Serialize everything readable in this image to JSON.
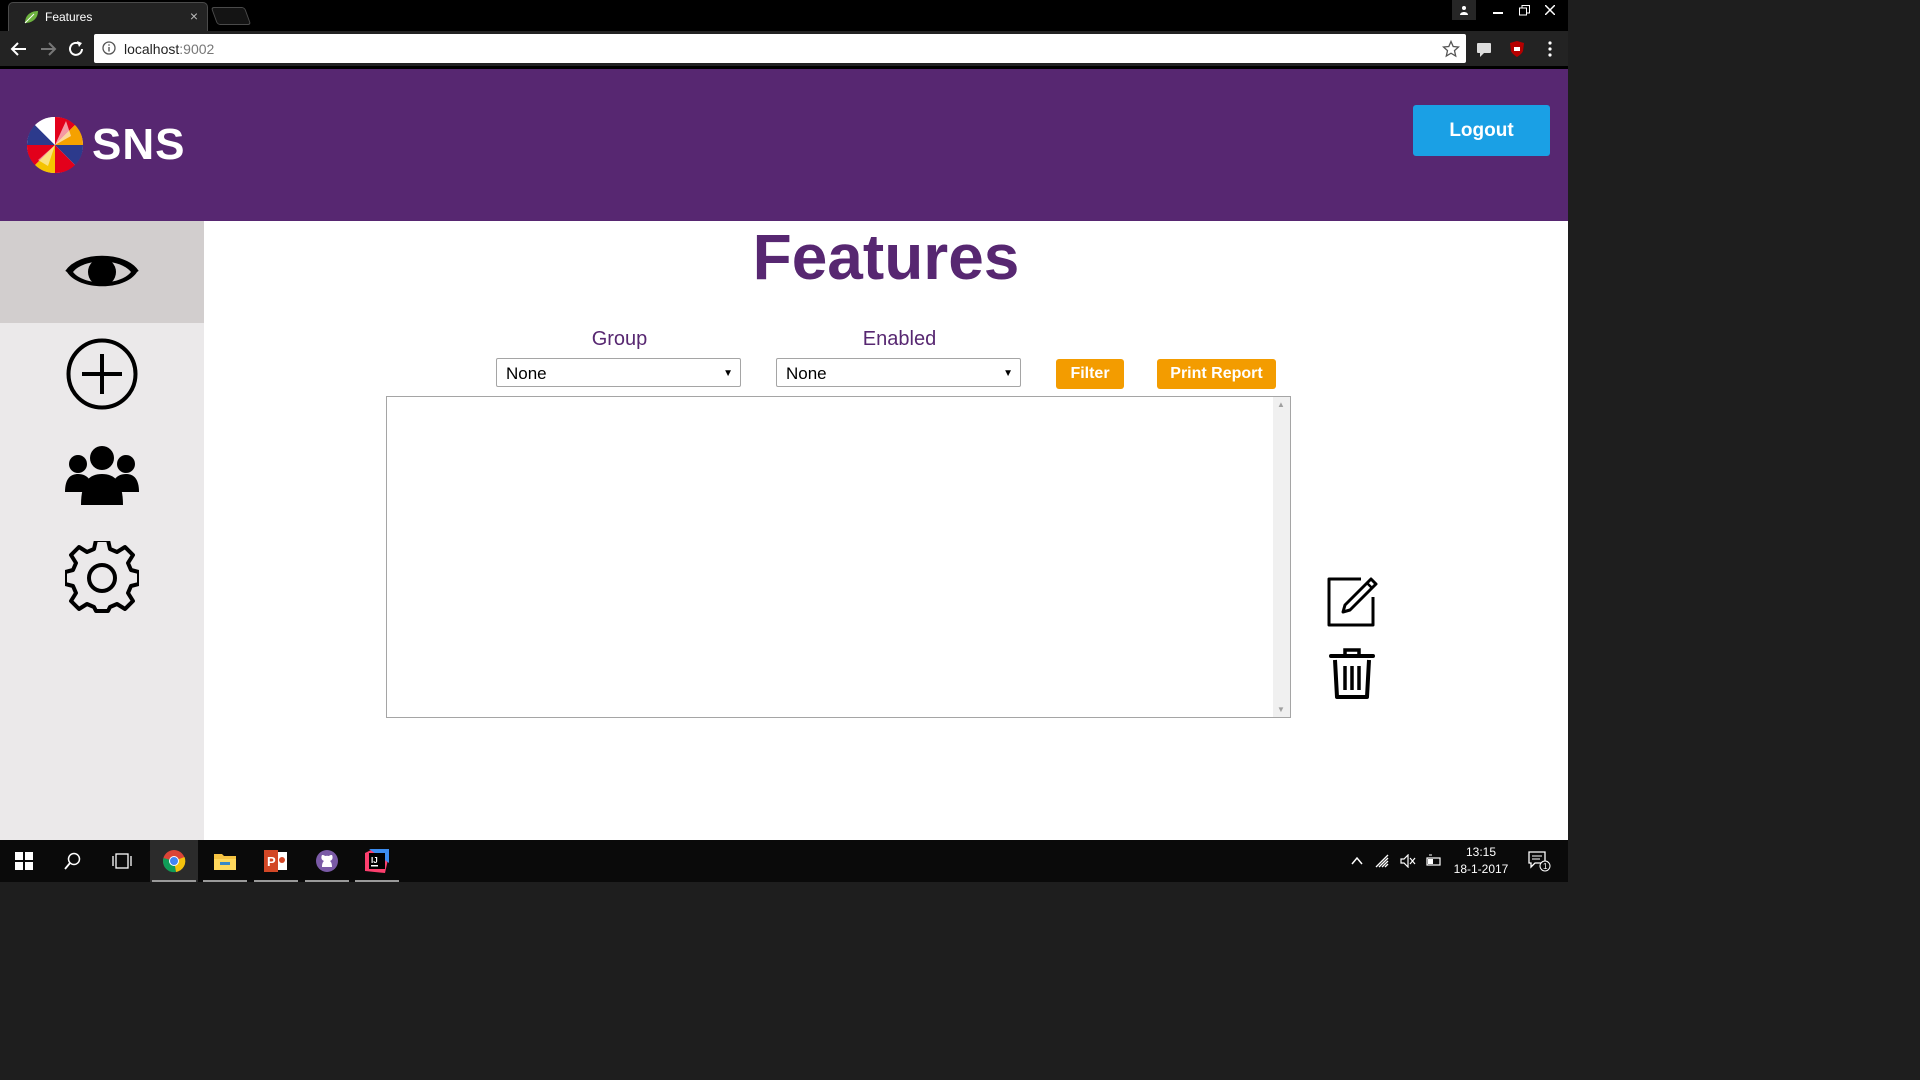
{
  "browser": {
    "tab_title": "Features",
    "tab_close": "×",
    "url_host": "localhost",
    "url_port": ":9002"
  },
  "header": {
    "logo_text": "SNS",
    "logout_label": "Logout"
  },
  "sidebar": {
    "items": [
      {
        "name": "overview",
        "icon": "eye-icon",
        "active": true
      },
      {
        "name": "add",
        "icon": "plus-circle-icon",
        "active": false
      },
      {
        "name": "groups",
        "icon": "users-icon",
        "active": false
      },
      {
        "name": "settings",
        "icon": "gear-icon",
        "active": false
      }
    ]
  },
  "main": {
    "title": "Features",
    "filters": {
      "group_label": "Group",
      "group_value": "None",
      "enabled_label": "Enabled",
      "enabled_value": "None"
    },
    "filter_button": "Filter",
    "print_button": "Print Report",
    "actions": [
      "edit-icon",
      "trash-icon"
    ]
  },
  "taskbar": {
    "time": "13:15",
    "date": "18-1-2017",
    "notification_count": "1"
  },
  "colors": {
    "brand_purple": "#572771",
    "accent_blue": "#1aa0e5",
    "accent_orange": "#f39c00"
  }
}
